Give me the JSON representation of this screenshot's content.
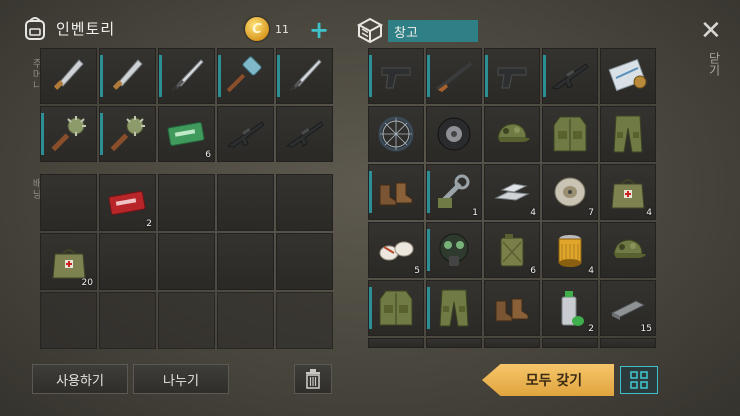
{
  "inventory": {
    "title": "인벤토리",
    "coin_symbol": "C",
    "coins": "11",
    "add_symbol": "+",
    "equipped_label": "주머니",
    "backpack_label": "배낭",
    "equipped": [
      {
        "icon": "machete-icon",
        "count": "",
        "bar": false
      },
      {
        "icon": "machete-icon",
        "count": "",
        "bar": true
      },
      {
        "icon": "sword-icon",
        "count": "",
        "bar": true
      },
      {
        "icon": "hammer-icon",
        "count": "",
        "bar": true
      },
      {
        "icon": "sword-icon",
        "count": "",
        "bar": true
      },
      {
        "icon": "mace-icon",
        "count": "",
        "bar": true
      },
      {
        "icon": "mace-icon",
        "count": "",
        "bar": true
      },
      {
        "icon": "ration-coupon-icon",
        "count": "6",
        "bar": false
      },
      {
        "icon": "assault-rifle-icon",
        "count": "",
        "bar": false
      },
      {
        "icon": "assault-rifle-icon",
        "count": "",
        "bar": false
      }
    ],
    "backpack": [
      {
        "icon": "",
        "count": ""
      },
      {
        "icon": "coupon-icon",
        "count": "2"
      },
      {
        "icon": "",
        "count": ""
      },
      {
        "icon": "",
        "count": ""
      },
      {
        "icon": "",
        "count": ""
      },
      {
        "icon": "medkit-bag-icon",
        "count": "20"
      },
      {
        "icon": "",
        "count": ""
      },
      {
        "icon": "",
        "count": ""
      },
      {
        "icon": "",
        "count": ""
      },
      {
        "icon": "",
        "count": ""
      },
      {
        "icon": "",
        "count": ""
      },
      {
        "icon": "",
        "count": ""
      },
      {
        "icon": "",
        "count": ""
      },
      {
        "icon": "",
        "count": ""
      },
      {
        "icon": "",
        "count": ""
      }
    ],
    "use_button": "사용하기",
    "split_button": "나누기",
    "trash_icon": "trash-icon"
  },
  "storage": {
    "title": "창고",
    "take_all_button": "모두 갖기",
    "items": [
      {
        "icon": "pistol-icon",
        "count": "",
        "bar": true
      },
      {
        "icon": "shotgun-icon",
        "count": "",
        "bar": true
      },
      {
        "icon": "pistol-icon",
        "count": "",
        "bar": true
      },
      {
        "icon": "assault-rifle-icon",
        "count": "",
        "bar": true
      },
      {
        "icon": "map-scroll-icon",
        "count": "",
        "bar": false
      },
      {
        "icon": "bicycle-wheel-icon",
        "count": "",
        "bar": false
      },
      {
        "icon": "tire-icon",
        "count": "",
        "bar": false
      },
      {
        "icon": "camo-cap-icon",
        "count": "",
        "bar": false
      },
      {
        "icon": "camo-vest-icon",
        "count": "",
        "bar": false
      },
      {
        "icon": "camo-pants-icon",
        "count": "",
        "bar": false
      },
      {
        "icon": "boots-icon",
        "count": "",
        "bar": true
      },
      {
        "icon": "wrench-parts-icon",
        "count": "1",
        "bar": true
      },
      {
        "icon": "metal-bars-icon",
        "count": "4",
        "bar": false
      },
      {
        "icon": "wire-spool-icon",
        "count": "7",
        "bar": false
      },
      {
        "icon": "medkit-bag-icon",
        "count": "4",
        "bar": false
      },
      {
        "icon": "bandage-icon",
        "count": "5",
        "bar": false
      },
      {
        "icon": "gas-mask-icon",
        "count": "",
        "bar": true
      },
      {
        "icon": "jerrycan-icon",
        "count": "6",
        "bar": false
      },
      {
        "icon": "oil-filter-icon",
        "count": "4",
        "bar": false
      },
      {
        "icon": "camo-cap-icon",
        "count": "",
        "bar": false
      },
      {
        "icon": "camo-vest-icon",
        "count": "",
        "bar": true
      },
      {
        "icon": "camo-pants-icon",
        "count": "",
        "bar": true
      },
      {
        "icon": "boots-icon",
        "count": "",
        "bar": false
      },
      {
        "icon": "spray-can-icon",
        "count": "2",
        "bar": false
      },
      {
        "icon": "whetstone-icon",
        "count": "15",
        "bar": false
      }
    ]
  },
  "close_symbol": "✕",
  "close_label": "닫기",
  "colors": {
    "accent": "#3fc1c9",
    "take_all": "#f0b24f",
    "bar": "#2b8f95"
  }
}
